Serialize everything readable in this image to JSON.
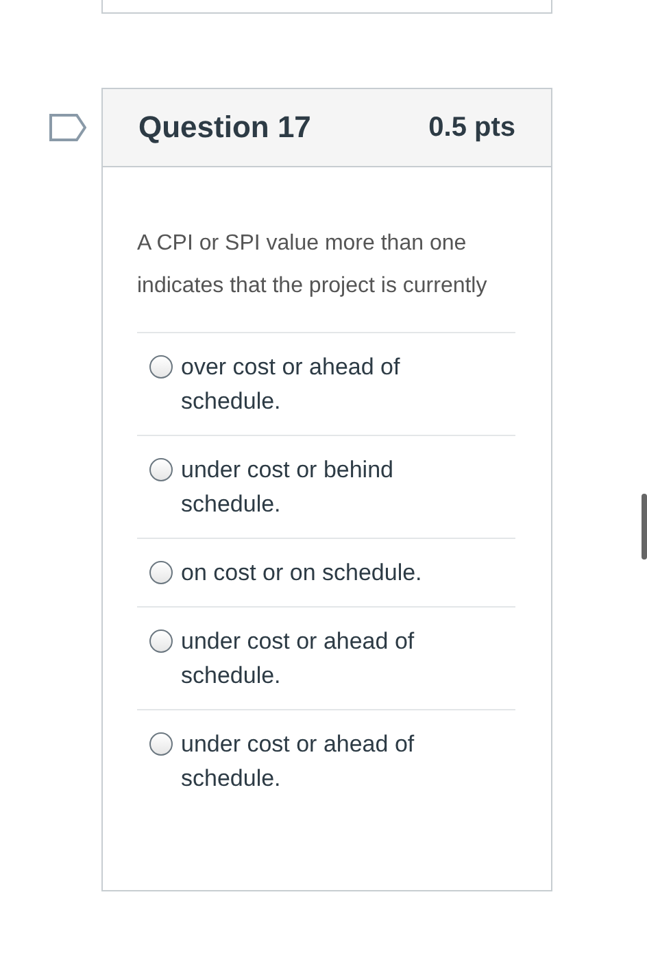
{
  "question": {
    "title": "Question 17",
    "points": "0.5 pts",
    "text": "A CPI or SPI value more than one indicates that the project is currently",
    "options": [
      {
        "label": "over cost or ahead of schedule.",
        "selected": false
      },
      {
        "label": "under cost or behind schedule.",
        "selected": false
      },
      {
        "label": "on cost or on schedule.",
        "selected": false
      },
      {
        "label": "under cost or ahead of schedule.",
        "selected": false
      },
      {
        "label": "under cost or ahead of schedule.",
        "selected": false
      }
    ]
  }
}
